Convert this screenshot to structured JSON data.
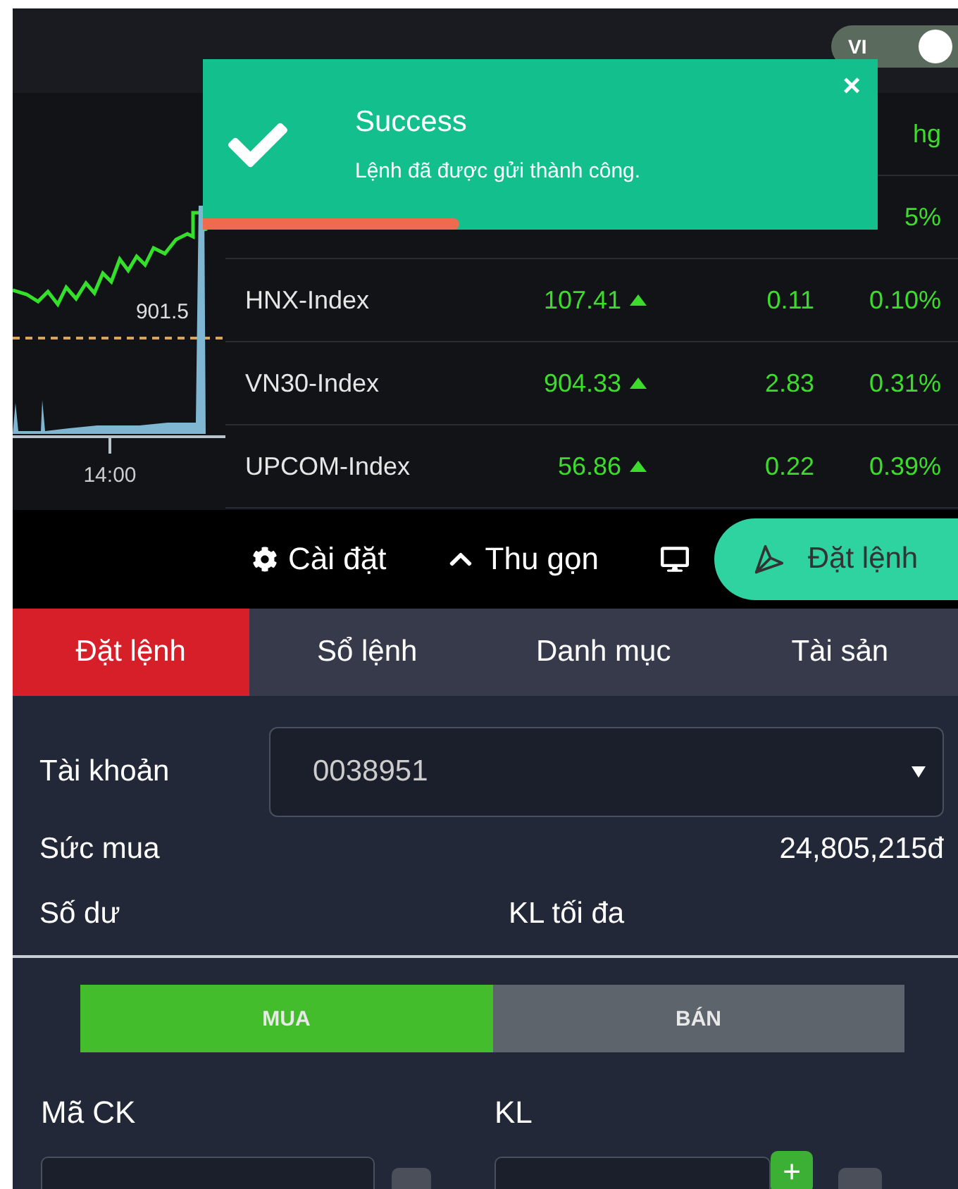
{
  "language_toggle": {
    "label": "VI",
    "on": true
  },
  "toast": {
    "kind": "success",
    "title": "Success",
    "message": "Lệnh đã được gửi thành công.",
    "close": "×",
    "level": 0.38
  },
  "chart": {
    "price_label": "901.5",
    "time_label": "14:00"
  },
  "index_table": {
    "header": "hg",
    "partial_row": {
      "percent": "5%"
    },
    "rows": [
      {
        "name": "HNX-Index",
        "value": "107.41",
        "change": "0.11",
        "percent": "0.10%",
        "up": true
      },
      {
        "name": "VN30-Index",
        "value": "904.33",
        "change": "2.83",
        "percent": "0.31%",
        "up": true
      },
      {
        "name": "UPCOM-Index",
        "value": "56.86",
        "change": "0.22",
        "percent": "0.39%",
        "up": true
      }
    ]
  },
  "toolbar": {
    "settings": "Cài đặt",
    "collapse": "Thu gọn",
    "order_button": "Đặt lệnh"
  },
  "tabs": [
    {
      "label": "Đặt lệnh",
      "selected": true
    },
    {
      "label": "Sổ lệnh",
      "selected": false
    },
    {
      "label": "Danh mục",
      "selected": false
    },
    {
      "label": "Tài sản",
      "selected": false
    }
  ],
  "account": {
    "label": "Tài khoản",
    "value": "0038951"
  },
  "info": [
    {
      "label": "Sức mua",
      "value": "24,805,215đ"
    },
    {
      "label": "Số dư",
      "label_2": "KL tối đa"
    }
  ],
  "sides": [
    {
      "label": "MUA",
      "selected": true
    },
    {
      "label": "BÁN",
      "selected": false
    }
  ],
  "fields": [
    {
      "label": "Mã CK"
    },
    {
      "label": "KL",
      "plus": "+"
    }
  ]
}
